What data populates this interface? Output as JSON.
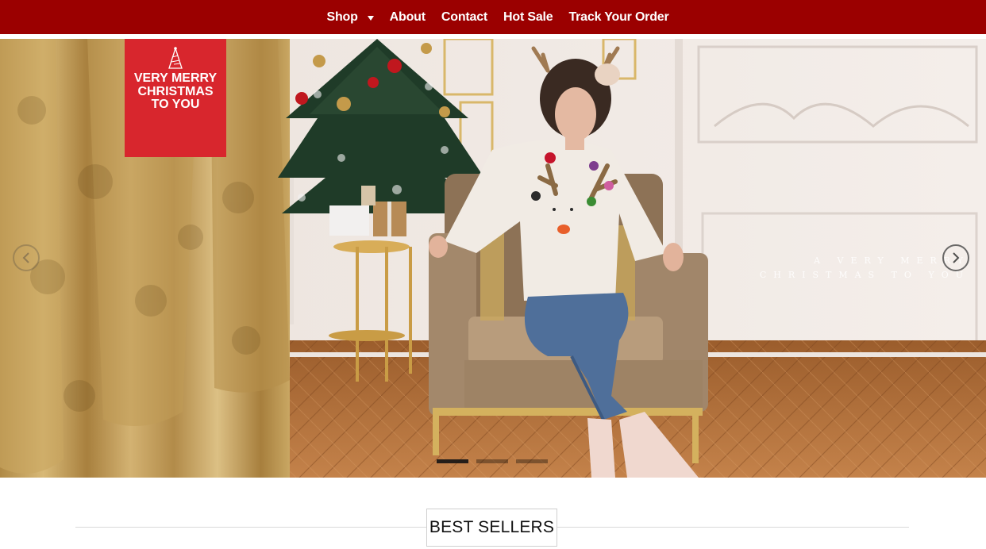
{
  "nav": {
    "items": [
      {
        "label": "Shop",
        "has_dropdown": true
      },
      {
        "label": "About"
      },
      {
        "label": "Contact"
      },
      {
        "label": "Hot Sale"
      },
      {
        "label": "Track Your Order"
      }
    ],
    "background_color": "#9b0000"
  },
  "hero": {
    "badge": {
      "icon": "christmas-tree-icon",
      "text": "Very Merry Christmas To You",
      "background_color": "#d8262d"
    },
    "caption": "A VERY MERRY CHRISTMAS TO YOU",
    "prev_icon": "chevron-left-icon",
    "next_icon": "chevron-right-icon",
    "slides_total": 3,
    "active_slide": 1
  },
  "best_sellers": {
    "title": "BEST SELLERS"
  }
}
